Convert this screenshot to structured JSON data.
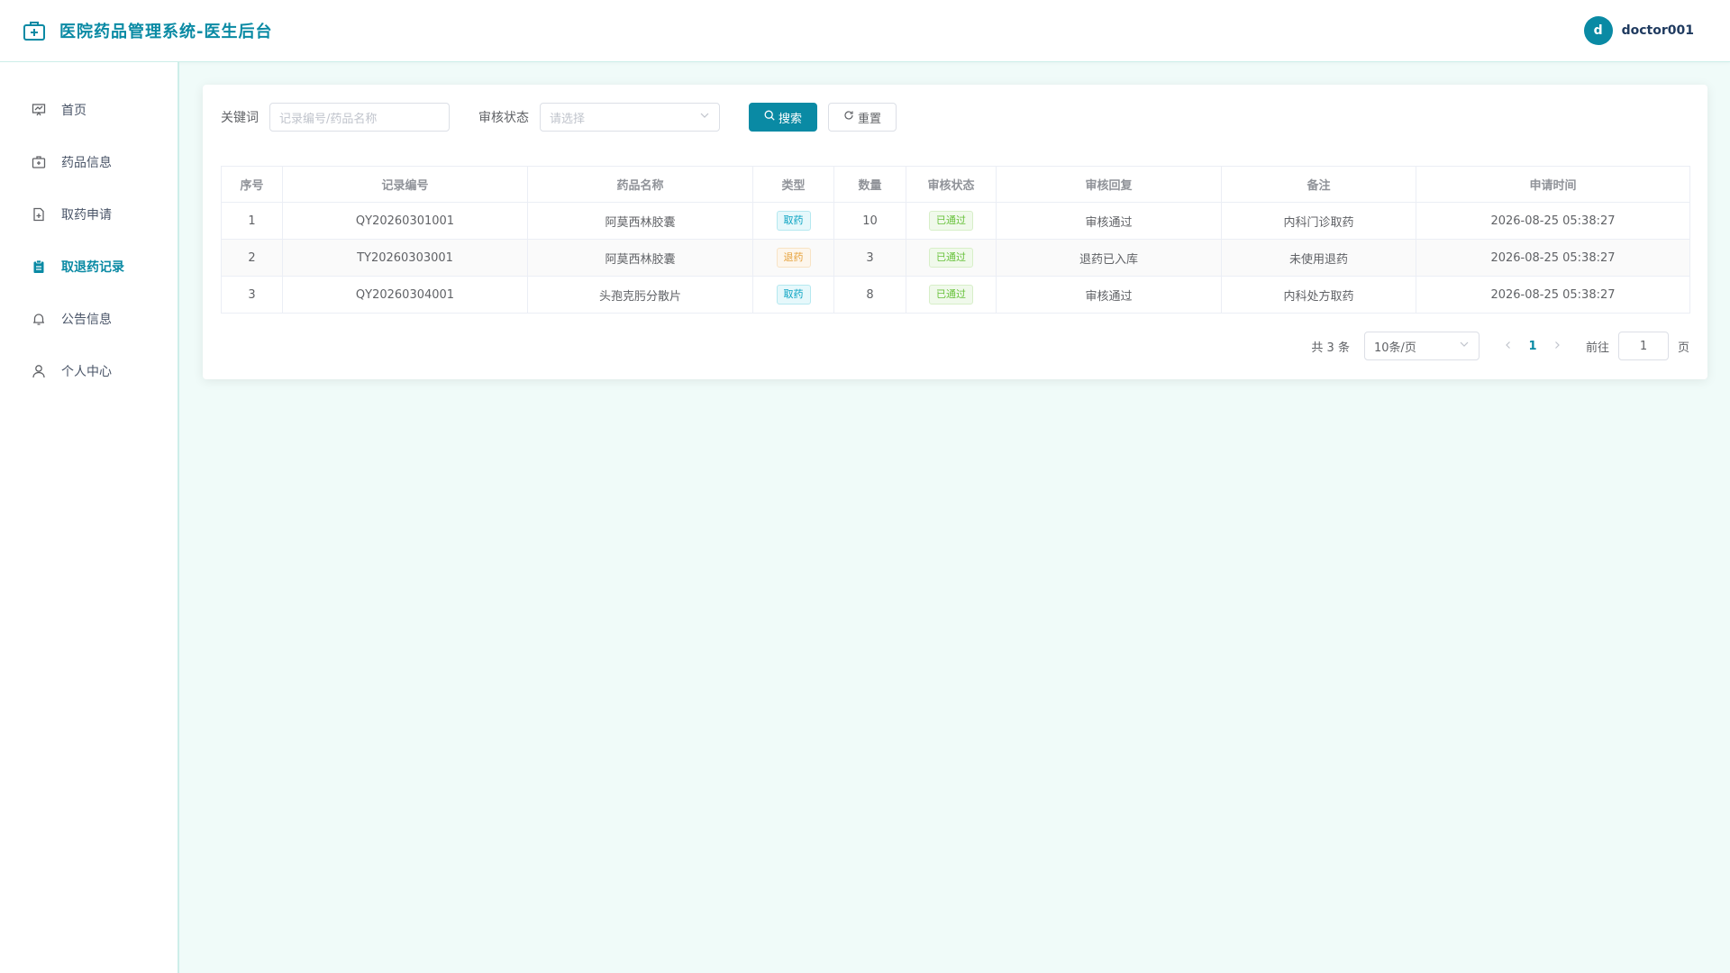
{
  "header": {
    "title": "医院药品管理系统-医生后台",
    "user": {
      "avatar_letter": "d",
      "name": "doctor001"
    }
  },
  "sidebar": {
    "items": [
      {
        "label": "首页",
        "icon": "dashboard-icon",
        "active": false
      },
      {
        "label": "药品信息",
        "icon": "medkit-icon",
        "active": false
      },
      {
        "label": "取药申请",
        "icon": "document-add-icon",
        "active": false
      },
      {
        "label": "取退药记录",
        "icon": "clipboard-icon",
        "active": true
      },
      {
        "label": "公告信息",
        "icon": "bell-icon",
        "active": false
      },
      {
        "label": "个人中心",
        "icon": "user-icon",
        "active": false
      }
    ]
  },
  "filters": {
    "keyword_label": "关键词",
    "keyword_placeholder": "记录编号/药品名称",
    "status_label": "审核状态",
    "status_placeholder": "请选择",
    "search_label": "搜索",
    "reset_label": "重置"
  },
  "table": {
    "headers": [
      "序号",
      "记录编号",
      "药品名称",
      "类型",
      "数量",
      "审核状态",
      "审核回复",
      "备注",
      "申请时间"
    ],
    "rows": [
      {
        "index": "1",
        "record_no": "QY20260301001",
        "drug": "阿莫西林胶囊",
        "type": "取药",
        "qty": "10",
        "status": "已通过",
        "reply": "审核通过",
        "note": "内科门诊取药",
        "time": "2026-08-25 05:38:27"
      },
      {
        "index": "2",
        "record_no": "TY20260303001",
        "drug": "阿莫西林胶囊",
        "type": "退药",
        "qty": "3",
        "status": "已通过",
        "reply": "退药已入库",
        "note": "未使用退药",
        "time": "2026-08-25 05:38:27"
      },
      {
        "index": "3",
        "record_no": "QY20260304001",
        "drug": "头孢克肟分散片",
        "type": "取药",
        "qty": "8",
        "status": "已通过",
        "reply": "审核通过",
        "note": "内科处方取药",
        "time": "2026-08-25 05:38:27"
      }
    ]
  },
  "pagination": {
    "total": "共 3 条",
    "page_size": "10条/页",
    "current_page": "1",
    "goto_label": "前往",
    "goto_value": "1",
    "page_suffix": "页"
  },
  "colors": {
    "accent": "#0a8aa4",
    "background": "#f0fbf9"
  }
}
